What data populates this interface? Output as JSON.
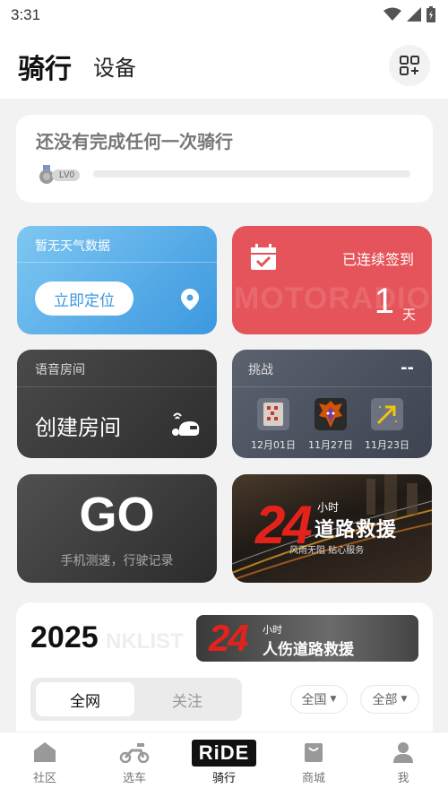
{
  "status_bar": {
    "time": "3:31"
  },
  "header": {
    "tab_ride": "骑行",
    "tab_device": "设备"
  },
  "ride_summary": {
    "empty_text": "还没有完成任何一次骑行",
    "level": "LV0"
  },
  "weather": {
    "title": "暂无天气数据",
    "locate_button": "立即定位"
  },
  "checkin": {
    "label": "已连续签到",
    "days": "1",
    "unit": "天",
    "watermark": "MOTORADIO"
  },
  "voice_room": {
    "title": "语音房间",
    "create_label": "创建房间"
  },
  "challenge": {
    "title": "挑战",
    "value": "--",
    "medals": [
      {
        "date": "12月01日"
      },
      {
        "date": "11月27日"
      },
      {
        "date": "11月23日"
      }
    ]
  },
  "go_card": {
    "title": "GO",
    "subtitle": "手机测速，行驶记录"
  },
  "rescue_banner": {
    "number": "24",
    "hour": "小时",
    "title": "道路救援",
    "subtitle": "风雨无阻 贴心服务"
  },
  "ranking": {
    "year": "2025",
    "ghost_text": "NKLIST",
    "banner": {
      "number": "24",
      "hour": "小时",
      "title": "人伤道路救援"
    },
    "segments": [
      "全网",
      "关注"
    ],
    "filter_region": "全国",
    "filter_type": "全部"
  },
  "bottom_nav": {
    "items": [
      "社区",
      "选车",
      "骑行",
      "商城",
      "我"
    ],
    "ride_logo": "RiDE"
  },
  "colors": {
    "weather": "#3b98df",
    "checkin": "#e5545a",
    "accent_red": "#e3231b"
  }
}
